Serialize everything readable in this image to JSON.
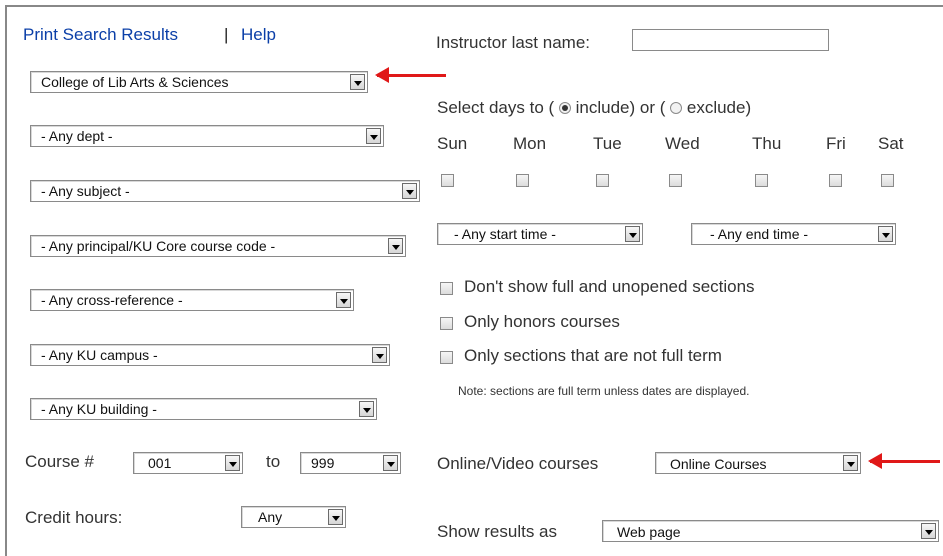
{
  "links": {
    "print": "Print Search Results",
    "separator": "|",
    "help": "Help"
  },
  "instructor": {
    "label": "Instructor last name:",
    "value": ""
  },
  "selects": {
    "college": "College of Lib Arts & Sciences",
    "dept": "- Any dept -",
    "subject": "- Any subject -",
    "principal": "- Any principal/KU Core course code -",
    "crossref": "- Any cross-reference -",
    "campus": "- Any KU campus -",
    "building": "- Any KU building -"
  },
  "course": {
    "label": "Course #",
    "from": "001",
    "to_label": "to",
    "to": "999"
  },
  "credit": {
    "label": "Credit hours:",
    "value": "Any"
  },
  "days": {
    "prompt_a": "Select days to (",
    "include": "include) or (",
    "exclude": "exclude)",
    "mode": "include",
    "labels": [
      "Sun",
      "Mon",
      "Tue",
      "Wed",
      "Thu",
      "Fri",
      "Sat"
    ]
  },
  "times": {
    "start": "- Any start time -",
    "end": "- Any end time -"
  },
  "options": {
    "full": "Don't show full and unopened sections",
    "honors": "Only honors courses",
    "fullterm": "Only sections that are not full term"
  },
  "note": "Note: sections are full term unless dates are displayed.",
  "online": {
    "label": "Online/Video courses",
    "value": "Online Courses"
  },
  "results": {
    "label": "Show results as",
    "value": "Web page"
  },
  "colors": {
    "link": "#0b3fa8",
    "arrow": "#e01818"
  },
  "icons": {
    "dropdown": "chevron-down-icon",
    "annotation": "red-arrow-icon"
  }
}
